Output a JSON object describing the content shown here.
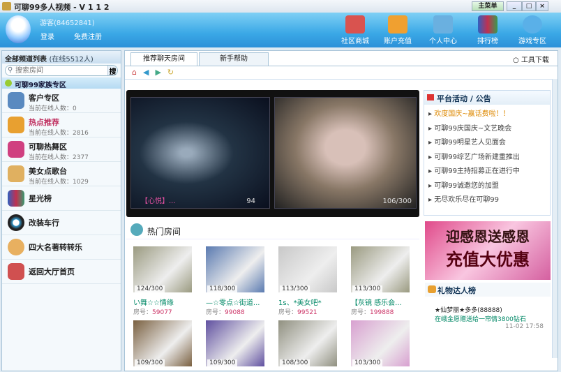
{
  "window": {
    "title": "可聊99多人视频 - V 1 1 2",
    "menu_label": "主菜单",
    "min": "_",
    "max": "□",
    "close": "×"
  },
  "user": {
    "name": "游客(84652841)",
    "login": "登录",
    "register": "免费注册"
  },
  "nav": [
    {
      "label": "社区商城",
      "color": "#d9534f"
    },
    {
      "label": "账户充值",
      "color": "#f0a030"
    },
    {
      "label": "个人中心",
      "color": "#6ab0e0"
    },
    {
      "label": "排行榜",
      "color": "#3a9a50"
    },
    {
      "label": "游戏专区",
      "color": "#5ab0e8"
    }
  ],
  "sidebar": {
    "title": "全部频道列表",
    "online": "(在线5512人)",
    "search_placeholder": "搜索房间",
    "search_btn": "搜索",
    "category": "可聊99家族专区",
    "items": [
      {
        "name": "客户专区",
        "online": "当前在线人数：0",
        "color": "#5a8ac0"
      },
      {
        "name": "热点推荐",
        "online": "当前在线人数：2816",
        "color": "#e8a030",
        "hot": true
      },
      {
        "name": "可聊热舞区",
        "online": "当前在线人数：2377",
        "color": "#d04080"
      },
      {
        "name": "美女点歌台",
        "online": "当前在线人数：1029",
        "color": "#e0b060"
      },
      {
        "name": "星光榜",
        "color": "#3a9a70"
      },
      {
        "name": "改装车行",
        "color": "#222"
      },
      {
        "name": "四大名著转转乐",
        "color": "#e8b060"
      },
      {
        "name": "返回大厅首页",
        "color": "#d05050"
      }
    ]
  },
  "tabs": [
    "推荐聊天房间",
    "新手帮助"
  ],
  "tools_download": "工具下载",
  "video": {
    "left_caption": "【心悦】...",
    "left_count": "94",
    "right_count": "106/300"
  },
  "notice": {
    "title": "平台活动 / 公告",
    "items": [
      "欢度国庆~赢话费啦！！",
      "可聊99庆国庆~文艺晚会",
      "可聊99明星艺人见面会",
      "可聊99综艺广场新建重推出",
      "可聊99主持招募正在进行中",
      "可聊99诚邀您的加盟",
      "无尽欢乐尽在可聊99"
    ]
  },
  "hot": {
    "title": "热门房间",
    "rooms": [
      {
        "count": "124/300",
        "name": "い舞☆☆情缘",
        "room_label": "房号：",
        "room": "59077",
        "bg": "#9a9a80"
      },
      {
        "count": "118/300",
        "name": "—☆零点☆街道...",
        "room_label": "房号：",
        "room": "99088",
        "bg": "#5a7ab0"
      },
      {
        "count": "113/300",
        "name": "1s、*美女吧*",
        "room_label": "房号：",
        "room": "99521",
        "bg": "#c8c8c8"
      },
      {
        "count": "113/300",
        "name": "【灰镜 感乐会...",
        "room_label": "房号：",
        "room": "199888",
        "bg": "#9a9a80"
      },
      {
        "count": "109/300",
        "bg": "#7a6040"
      },
      {
        "count": "109/300",
        "bg": "#6050a0"
      },
      {
        "count": "108/300",
        "bg": "#909080"
      },
      {
        "count": "103/300",
        "bg": "#d8a0d0"
      }
    ]
  },
  "banner": {
    "line1": "迎感恩送感恩",
    "line2": "充值大优惠"
  },
  "gift": {
    "title": "礼物达人榜",
    "entry_user": "★仙梦丽★多多(88888)",
    "entry_text": "在峨金愿赠送给一帘情3800钻石",
    "entry_time": "11-02 17:58"
  }
}
